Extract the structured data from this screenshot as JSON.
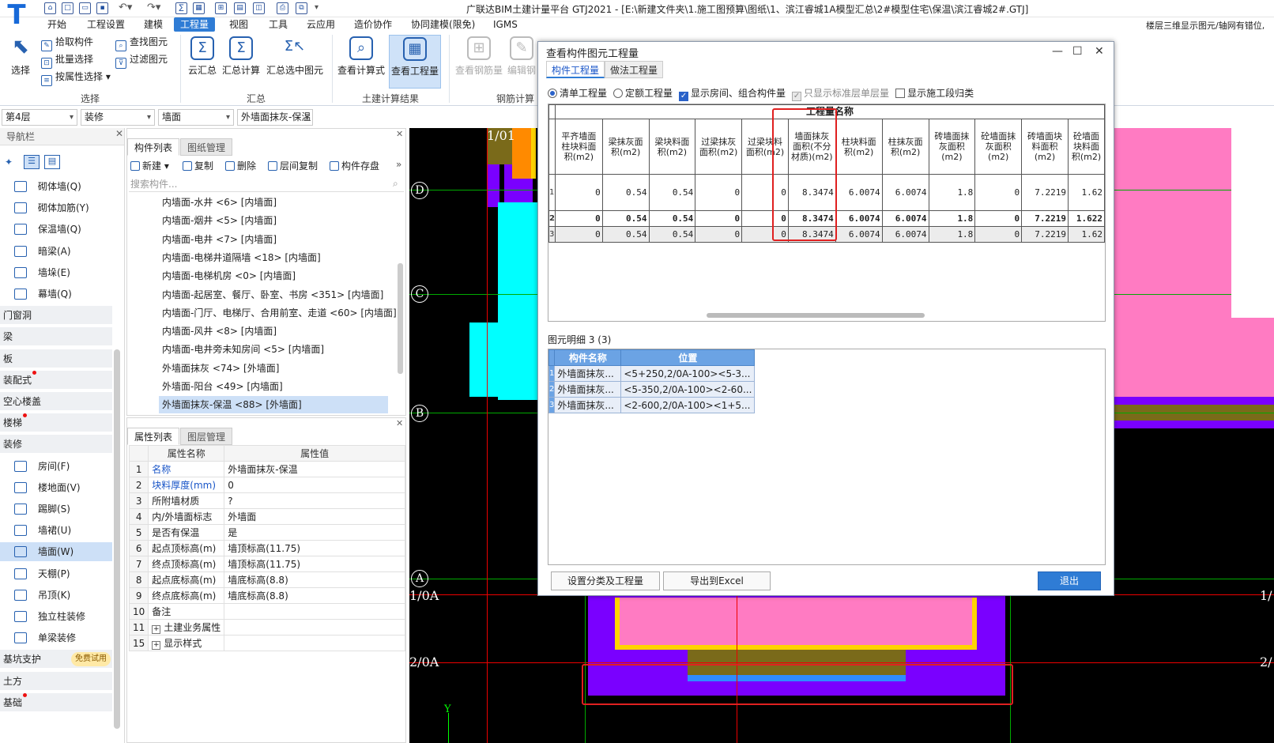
{
  "titlebar": {
    "title": "广联达BIM土建计量平台 GTJ2021 - [E:\\新建文件夹\\1.施工图预算\\图纸\\1、滨江睿城1A模型汇总\\2#模型住宅\\保温\\滨江睿城2#.GTJ]",
    "extra": "楼层三维显示图元/轴网有错位,"
  },
  "menubar": [
    "开始",
    "工程设置",
    "建模",
    "工程量",
    "视图",
    "工具",
    "云应用",
    "造价协作",
    "协同建模(限免)",
    "IGMS"
  ],
  "menu_active": "工程量",
  "ribbon": {
    "select": "选择",
    "pick": "拾取构件",
    "batch": "批量选择",
    "byprop": "按属性选择",
    "find": "查找图元",
    "filter": "过滤图元",
    "group_select": "选择",
    "cloud_sum": "云汇总",
    "sum_calc": "汇总计算",
    "sum_selected": "汇总选中图元",
    "group_sum": "汇总",
    "view_formula": "查看计算式",
    "view_qty": "查看工程量",
    "group_result": "土建计算结果",
    "view_rebar": "查看钢筋量",
    "edit_rebar": "编辑钢",
    "group_rebar": "钢筋计算"
  },
  "filterbar": {
    "floor": "第4层",
    "type": "装修",
    "sub": "墙面",
    "comp": "外墙面抹灰-保温"
  },
  "nav": {
    "header": "导航栏",
    "items": [
      {
        "label": "砌体墙(Q)",
        "kind": "sub"
      },
      {
        "label": "砌体加筋(Y)",
        "kind": "sub"
      },
      {
        "label": "保温墙(Q)",
        "kind": "sub"
      },
      {
        "label": "暗梁(A)",
        "kind": "sub"
      },
      {
        "label": "墙垛(E)",
        "kind": "sub"
      },
      {
        "label": "幕墙(Q)",
        "kind": "sub"
      },
      {
        "label": "门窗洞",
        "kind": "cat"
      },
      {
        "label": "梁",
        "kind": "cat"
      },
      {
        "label": "板",
        "kind": "cat"
      },
      {
        "label": "装配式",
        "kind": "cat",
        "dot": true
      },
      {
        "label": "空心楼盖",
        "kind": "cat"
      },
      {
        "label": "楼梯",
        "kind": "cat",
        "dot": true
      },
      {
        "label": "装修",
        "kind": "cat"
      },
      {
        "label": "房间(F)",
        "kind": "sub"
      },
      {
        "label": "楼地面(V)",
        "kind": "sub"
      },
      {
        "label": "踢脚(S)",
        "kind": "sub"
      },
      {
        "label": "墙裙(U)",
        "kind": "sub"
      },
      {
        "label": "墙面(W)",
        "kind": "sub",
        "sel": true
      },
      {
        "label": "天棚(P)",
        "kind": "sub"
      },
      {
        "label": "吊顶(K)",
        "kind": "sub"
      },
      {
        "label": "独立柱装修",
        "kind": "sub"
      },
      {
        "label": "单梁装修",
        "kind": "sub"
      },
      {
        "label": "基坑支护",
        "kind": "cat",
        "badge": "免费试用"
      },
      {
        "label": "土方",
        "kind": "cat"
      },
      {
        "label": "基础",
        "kind": "cat",
        "dot": true
      }
    ]
  },
  "complist": {
    "tabs": [
      "构件列表",
      "图纸管理"
    ],
    "toolbar": [
      "新建",
      "复制",
      "删除",
      "层间复制",
      "构件存盘"
    ],
    "search_placeholder": "搜索构件...",
    "items": [
      "内墙面-水井 <6> [内墙面]",
      "内墙面-烟井 <5> [内墙面]",
      "内墙面-电井 <7> [内墙面]",
      "内墙面-电梯井道隔墙 <18> [内墙面]",
      "内墙面-电梯机房 <0> [内墙面]",
      "内墙面-起居室、餐厅、卧室、书房 <351> [内墙面]",
      "内墙面-门厅、电梯厅、合用前室、走道 <60> [内墙面]",
      "内墙面-风井 <8> [内墙面]",
      "内墙面-电井旁未知房间 <5> [内墙面]",
      "外墙面抹灰 <74> [外墙面]",
      "外墙面-阳台 <49> [内墙面]",
      "外墙面抹灰-保温 <88> [外墙面]"
    ]
  },
  "proplist": {
    "tabs": [
      "属性列表",
      "图层管理"
    ],
    "headers": [
      "属性名称",
      "属性值"
    ],
    "rows": [
      {
        "n": "1",
        "name": "名称",
        "val": "外墙面抹灰-保温",
        "blue": true
      },
      {
        "n": "2",
        "name": "块料厚度(mm)",
        "val": "0",
        "blue": true
      },
      {
        "n": "3",
        "name": "所附墙材质",
        "val": "?"
      },
      {
        "n": "4",
        "name": "内/外墙面标志",
        "val": "外墙面"
      },
      {
        "n": "5",
        "name": "是否有保温",
        "val": "是"
      },
      {
        "n": "6",
        "name": "起点顶标高(m)",
        "val": "墙顶标高(11.75)"
      },
      {
        "n": "7",
        "name": "终点顶标高(m)",
        "val": "墙顶标高(11.75)"
      },
      {
        "n": "8",
        "name": "起点底标高(m)",
        "val": "墙底标高(8.8)"
      },
      {
        "n": "9",
        "name": "终点底标高(m)",
        "val": "墙底标高(8.8)"
      },
      {
        "n": "10",
        "name": "备注",
        "val": ""
      },
      {
        "n": "11",
        "name": "土建业务属性",
        "val": "",
        "expand": true
      },
      {
        "n": "15",
        "name": "显示样式",
        "val": "",
        "expand": true
      }
    ]
  },
  "canvas": {
    "axes": [
      "D",
      "C",
      "B",
      "A"
    ],
    "labels": [
      "1/01",
      "1/0A",
      "2/0A",
      "1/",
      "2/"
    ],
    "y_marker": "Y"
  },
  "dialog": {
    "title": "查看构件图元工程量",
    "tabs": [
      "构件工程量",
      "做法工程量"
    ],
    "options": [
      {
        "label": "清单工程量",
        "type": "radio",
        "on": true
      },
      {
        "label": "定额工程量",
        "type": "radio",
        "on": false
      },
      {
        "label": "显示房间、组合构件量",
        "type": "check",
        "on": true
      },
      {
        "label": "只显示标准层单层量",
        "type": "check",
        "on": true,
        "dim": true
      },
      {
        "label": "显示施工段归类",
        "type": "check",
        "on": false
      }
    ],
    "grid_super": "工程量名称",
    "columns": [
      "平齐墙面柱块料面积(m2)",
      "梁抹灰面积(m2)",
      "梁块料面积(m2)",
      "过梁抹灰面积(m2)",
      "过梁块料面积(m2)",
      "墙面抹灰面积(不分材质)(m2)",
      "柱块料面积(m2)",
      "柱抹灰面积(m2)",
      "砖墙面抹灰面积(m2)",
      "砼墙面抹灰面积(m2)",
      "砖墙面块料面积(m2)",
      "砼墙面块料面积(m2)"
    ],
    "rows": [
      [
        "1",
        "0",
        "0.54",
        "0.54",
        "0",
        "0",
        "8.3474",
        "6.0074",
        "6.0074",
        "1.8",
        "0",
        "7.2219",
        "1.62"
      ],
      [
        "2",
        "0",
        "0.54",
        "0.54",
        "0",
        "0",
        "8.3474",
        "6.0074",
        "6.0074",
        "1.8",
        "0",
        "7.2219",
        "1.622"
      ],
      [
        "3",
        "0",
        "0.54",
        "0.54",
        "0",
        "0",
        "8.3474",
        "6.0074",
        "6.0074",
        "1.8",
        "0",
        "7.2219",
        "1.62"
      ]
    ],
    "detail_label": "图元明细  3 (3)",
    "detail_headers": [
      "构件名称",
      "位置"
    ],
    "detail_rows": [
      [
        "1",
        "外墙面抹灰...",
        "<5+250,2/0A-100><5-3..."
      ],
      [
        "2",
        "外墙面抹灰...",
        "<5-350,2/0A-100><2-60..."
      ],
      [
        "3",
        "外墙面抹灰...",
        "<2-600,2/0A-100><1+5..."
      ]
    ],
    "btn_set": "设置分类及工程量",
    "btn_export": "导出到Excel",
    "btn_exit": "退出"
  },
  "colors": {
    "accent": "#2f7cd5",
    "highlight": "#e02020"
  }
}
